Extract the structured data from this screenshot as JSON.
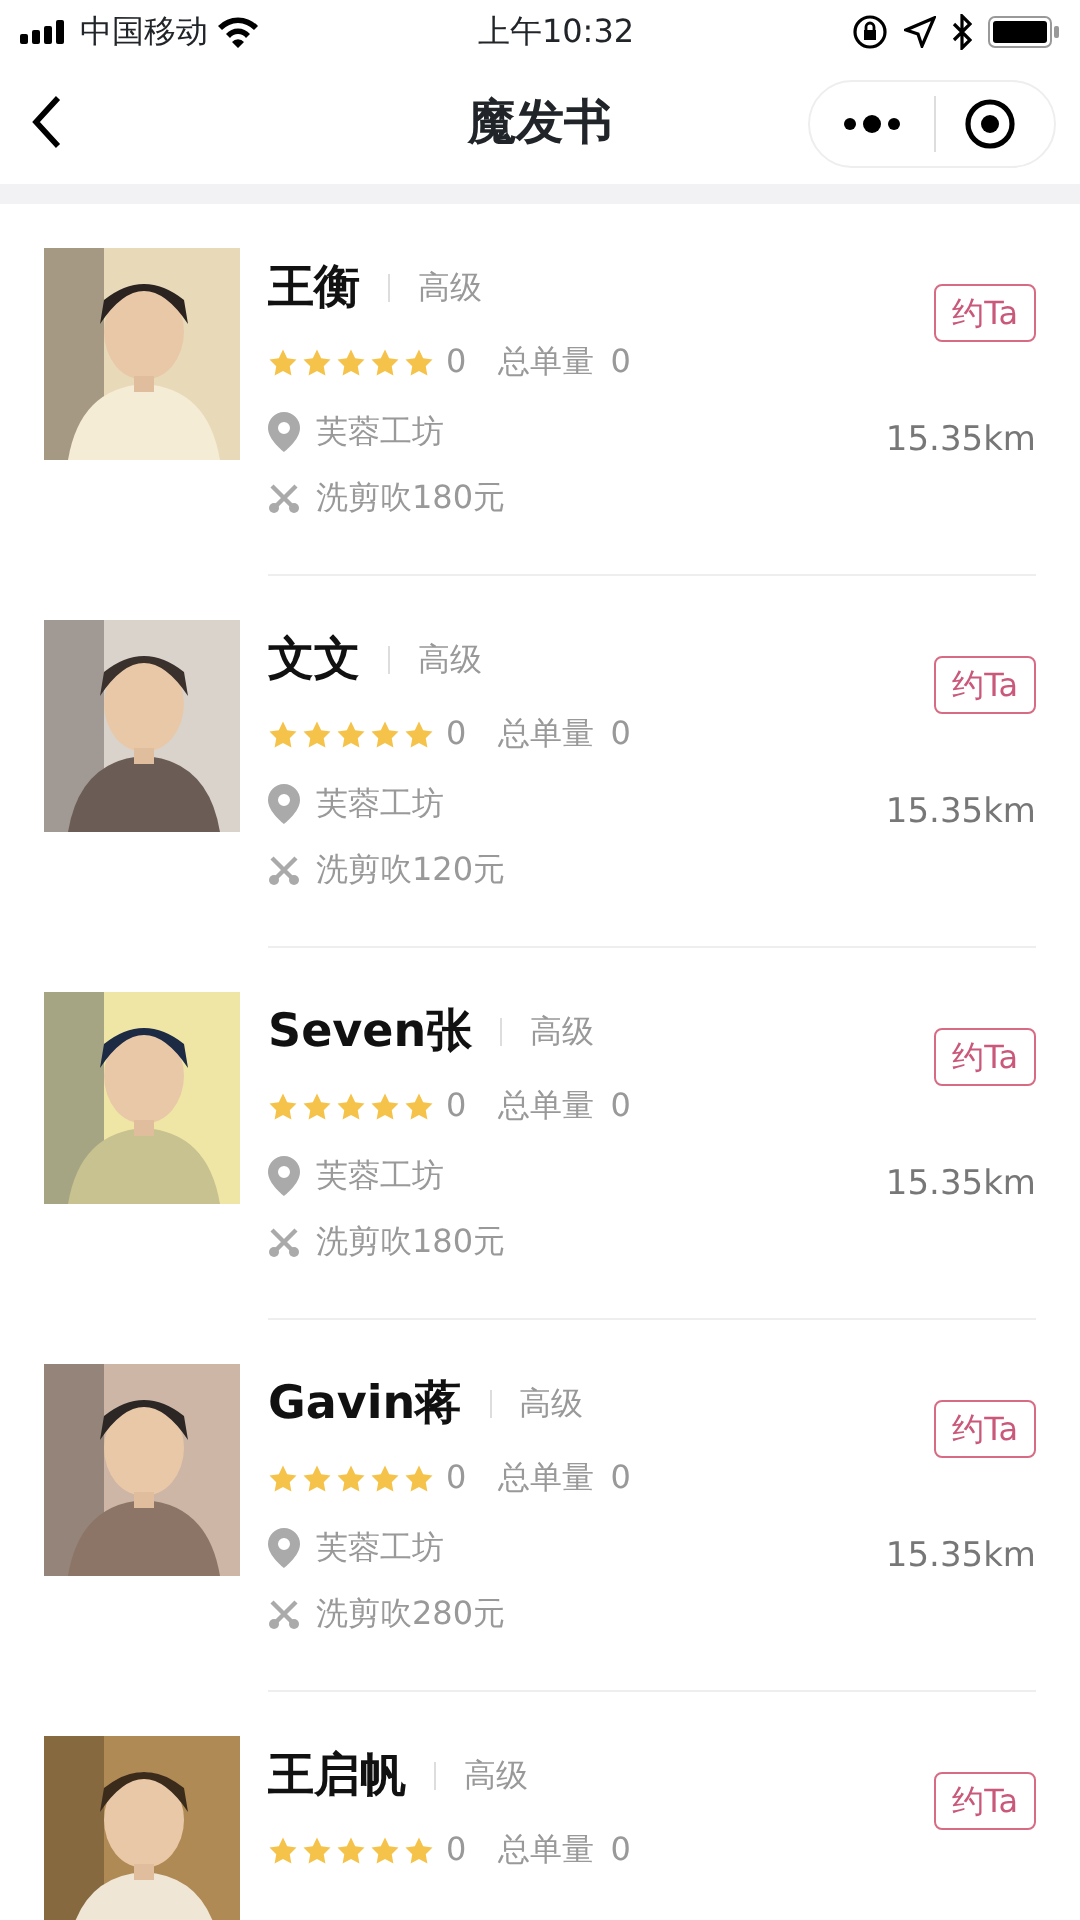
{
  "status_bar": {
    "carrier": "中国移动",
    "time": "上午10:32"
  },
  "nav": {
    "title": "魔发书"
  },
  "stylists": [
    {
      "name": "王衡",
      "level": "高级",
      "stars": 5,
      "rating": "0",
      "orders_label": "总单量",
      "orders": "0",
      "location": "芙蓉工坊",
      "distance": "15.35km",
      "service": "洗剪吹180元",
      "button": "约Ta"
    },
    {
      "name": "文文",
      "level": "高级",
      "stars": 5,
      "rating": "0",
      "orders_label": "总单量",
      "orders": "0",
      "location": "芙蓉工坊",
      "distance": "15.35km",
      "service": "洗剪吹120元",
      "button": "约Ta"
    },
    {
      "name": "Seven张",
      "level": "高级",
      "stars": 5,
      "rating": "0",
      "orders_label": "总单量",
      "orders": "0",
      "location": "芙蓉工坊",
      "distance": "15.35km",
      "service": "洗剪吹180元",
      "button": "约Ta"
    },
    {
      "name": "Gavin蒋",
      "level": "高级",
      "stars": 5,
      "rating": "0",
      "orders_label": "总单量",
      "orders": "0",
      "location": "芙蓉工坊",
      "distance": "15.35km",
      "service": "洗剪吹280元",
      "button": "约Ta"
    },
    {
      "name": "王启帆",
      "level": "高级",
      "stars": 5,
      "rating": "0",
      "orders_label": "总单量",
      "orders": "0",
      "button": "约Ta"
    }
  ]
}
